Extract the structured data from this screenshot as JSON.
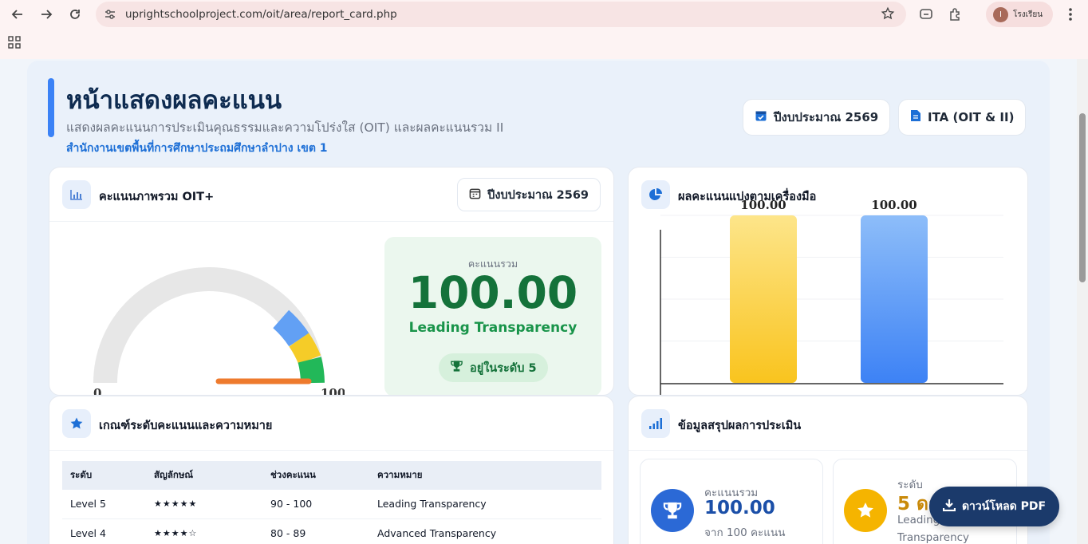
{
  "browser": {
    "url": "uprightschoolproject.com/oit/area/report_card.php",
    "profile_initial": "I",
    "profile_name": "โรงเรียน"
  },
  "header": {
    "title": "หน้าแสดงผลคะแนน",
    "subtitle": "แสดงผลคะแนนการประเมินคุณธรรมและความโปร่งใส (OIT) และผลคะแนนรวม II",
    "organization": "สำนักงานเขตพื้นที่การศึกษาประถมศึกษาลำปาง เขต 1",
    "year_pill": "ปีงบประมาณ 2569",
    "ita_pill": "ITA (OIT & II)"
  },
  "overview": {
    "title": "คะแนนภาพรวม OIT+",
    "year_pill": "ปีงบประมาณ 2569",
    "gauge": {
      "min": "0",
      "max": "100",
      "value": 100
    },
    "score_label": "คะแนนรวม",
    "score": "100.00",
    "level_name": "Leading Transparency",
    "level_badge": "อยู่ในระดับ 5"
  },
  "tools": {
    "title": "ผลคะแนนแบ่งตามเครื่องมือ"
  },
  "chart_data": {
    "type": "bar",
    "categories": [
      "",
      ""
    ],
    "values": [
      100,
      100
    ],
    "data_labels": [
      "100.00",
      "100.00"
    ],
    "colors": [
      "#f9c41e",
      "#3d82f5"
    ],
    "ylim": [
      0,
      100
    ],
    "grid": true
  },
  "criteria": {
    "title": "เกณฑ์ระดับคะแนนและความหมาย",
    "columns": [
      "ระดับ",
      "สัญลักษณ์",
      "ช่วงคะแนน",
      "ความหมาย"
    ],
    "rows": [
      {
        "level": "Level 5",
        "stars": "★★★★★",
        "range": "90 - 100",
        "meaning": "Leading Transparency"
      },
      {
        "level": "Level 4",
        "stars": "★★★★☆",
        "range": "80 - 89",
        "meaning": "Advanced Transparency"
      }
    ]
  },
  "summary": {
    "title": "ข้อมูลสรุปผลการประเมิน",
    "total_label": "คะแนนรวม",
    "total_value": "100.00",
    "total_sub": "จาก 100 คะแนน",
    "level_label": "ระดับ",
    "level_value": "5 ดา",
    "level_sub1": "Leading",
    "level_sub2": "Transparency"
  },
  "download_button": "ดาวน์โหลด PDF",
  "colors": {
    "accent": "#3b82f6",
    "navy": "#0e2b50",
    "green": "#14723a",
    "gold": "#f5b400"
  }
}
